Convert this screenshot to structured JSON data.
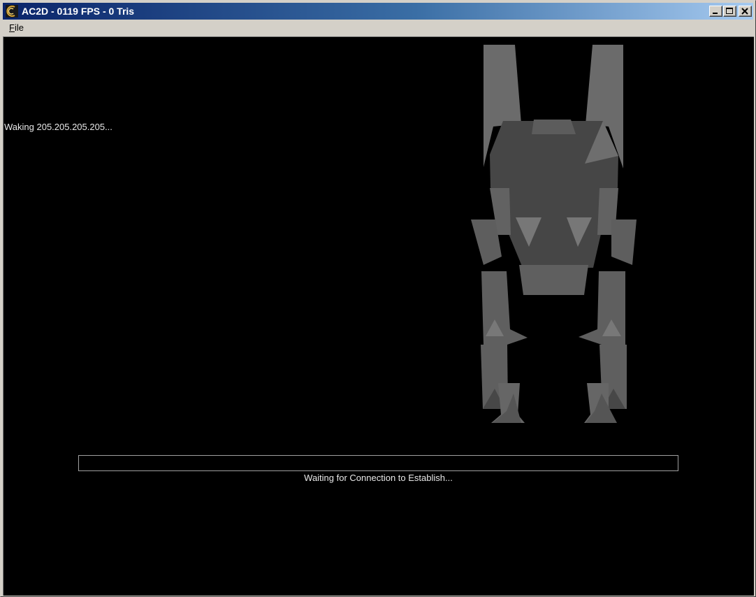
{
  "window": {
    "title": "AC2D - 0119 FPS - 0 Tris"
  },
  "menu": {
    "file_hotkey": "F",
    "file_rest": "ile"
  },
  "viewport": {
    "status_message": "Waking 205.205.205.205...",
    "connection_status": "Waiting for Connection to Establish...",
    "progress_fraction": 0,
    "background_color": "#000000"
  },
  "colors": {
    "title_gradient_start": "#0a246a",
    "title_gradient_end": "#a6caf0",
    "window_face": "#d4d0c8"
  },
  "icons": [
    "app-icon",
    "minimize-icon",
    "maximize-icon",
    "close-icon"
  ]
}
